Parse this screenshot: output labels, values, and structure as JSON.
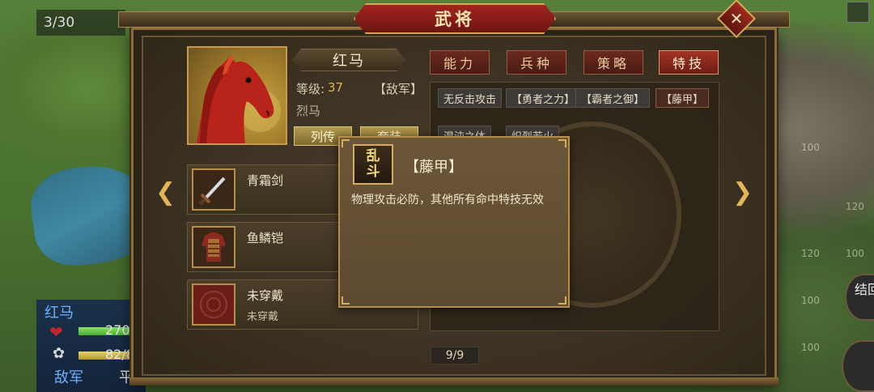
{
  "hud": {
    "turn_counter": "3/30",
    "right_button_1": "结回",
    "tile_labels": [
      "120",
      "100",
      "120",
      "120",
      "100",
      "100",
      "100",
      "120"
    ]
  },
  "unit_card": {
    "name": "红马",
    "tag": "敌",
    "hp_value": "270/",
    "sp_value": "82/8",
    "side": "敌军",
    "mode": "平"
  },
  "dialog": {
    "title": "武将",
    "close_label": "✕"
  },
  "profile": {
    "name": "红马",
    "level_label": "等级:",
    "level_value": "37",
    "faction": "【敌军】",
    "unit_class": "烈马",
    "biography_button": "列传",
    "set_button": "套装"
  },
  "equipment": [
    {
      "name": "青霜剑",
      "sub": ""
    },
    {
      "name": "鱼鳞铠",
      "sub": ""
    },
    {
      "name": "未穿戴",
      "sub": "未穿戴"
    }
  ],
  "tabs": [
    {
      "label": "能力",
      "active": false
    },
    {
      "label": "兵种",
      "active": false
    },
    {
      "label": "策略",
      "active": false
    },
    {
      "label": "特技",
      "active": true
    }
  ],
  "skills": [
    "无反击攻击",
    "【勇者之力】",
    "【霸者之御】",
    "【藤甲】",
    "混沌之体",
    "炽烈若火"
  ],
  "pager": "9/9",
  "tooltip": {
    "icon_line1": "乱",
    "icon_line2": "斗",
    "title": "【藤甲】",
    "description": "物理攻击必防，其他所有命中特技无效"
  },
  "colors": {
    "title_plate": "#a3251f",
    "active_tab": "#a33325",
    "accent_gold": "#d4a75c",
    "enemy_blue": "#6cb0ff"
  },
  "bars": {
    "hp_fill_percent": 95,
    "sp_fill_percent": 95
  }
}
